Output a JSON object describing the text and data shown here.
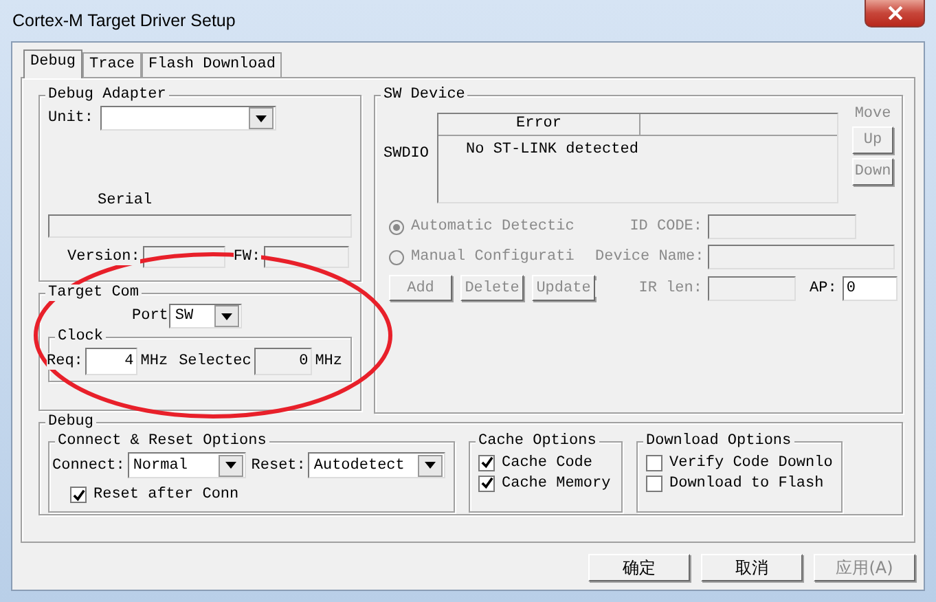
{
  "window": {
    "title": "Cortex-M Target Driver Setup"
  },
  "tabs": [
    {
      "label": "Debug",
      "selected": true
    },
    {
      "label": "Trace",
      "selected": false
    },
    {
      "label": "Flash Download",
      "selected": false
    }
  ],
  "debug_adapter": {
    "title": "Debug Adapter",
    "unit": {
      "label": "Unit:"
    },
    "serial_label": "Serial",
    "version_label": "Version:",
    "fw_label": "FW:"
  },
  "sw_device": {
    "title": "SW Device",
    "row_label": "SWDIO",
    "columns": [
      "Error"
    ],
    "message": "No ST-LINK detected",
    "move_label": "Move",
    "move_buttons": [
      {
        "label": "Up",
        "disabled": true
      },
      {
        "label": "Down",
        "disabled": true
      }
    ],
    "radios": [
      {
        "label": "Automatic Detectic",
        "selected": true,
        "disabled": true
      },
      {
        "label": "Manual Configurati",
        "selected": false,
        "disabled": true
      }
    ],
    "id_code": {
      "label": "ID CODE:",
      "disabled": true
    },
    "device_name": {
      "label": "Device Name:",
      "disabled": true
    },
    "edit_buttons": [
      {
        "label": "Add",
        "disabled": true
      },
      {
        "label": "Delete",
        "disabled": true
      },
      {
        "label": "Update",
        "disabled": true
      }
    ],
    "ir_len": {
      "label": "IR len:",
      "disabled": true
    },
    "ap": {
      "label": "AP:",
      "value": "0"
    }
  },
  "target_com": {
    "title": "Target Com",
    "port": {
      "label": "Port",
      "value": "SW"
    },
    "clock": {
      "title": "Clock",
      "req_label": "Req:",
      "req_value": "4",
      "req_unit": "MHz",
      "selected_label": "Selectec",
      "selected_value": "0",
      "selected_unit": "MHz"
    }
  },
  "debug": {
    "title": "Debug",
    "connect_reset": {
      "title": "Connect & Reset Options",
      "connect": {
        "label": "Connect:",
        "value": "Normal"
      },
      "reset": {
        "label": "Reset:",
        "value": "Autodetect"
      },
      "checkboxes": [
        {
          "label": "Reset after Conn",
          "checked": true
        }
      ]
    },
    "cache_options": {
      "title": "Cache Options",
      "checkboxes": [
        {
          "label": "Cache Code",
          "checked": true
        },
        {
          "label": "Cache Memory",
          "checked": true
        }
      ]
    },
    "download_options": {
      "title": "Download Options",
      "checkboxes": [
        {
          "label": "Verify Code Downlo",
          "checked": false
        },
        {
          "label": "Download to Flash",
          "checked": false
        }
      ]
    }
  },
  "buttons": [
    {
      "label": "确定",
      "disabled": false
    },
    {
      "label": "取消",
      "disabled": false
    },
    {
      "label": "应用(A)",
      "disabled": true
    }
  ]
}
